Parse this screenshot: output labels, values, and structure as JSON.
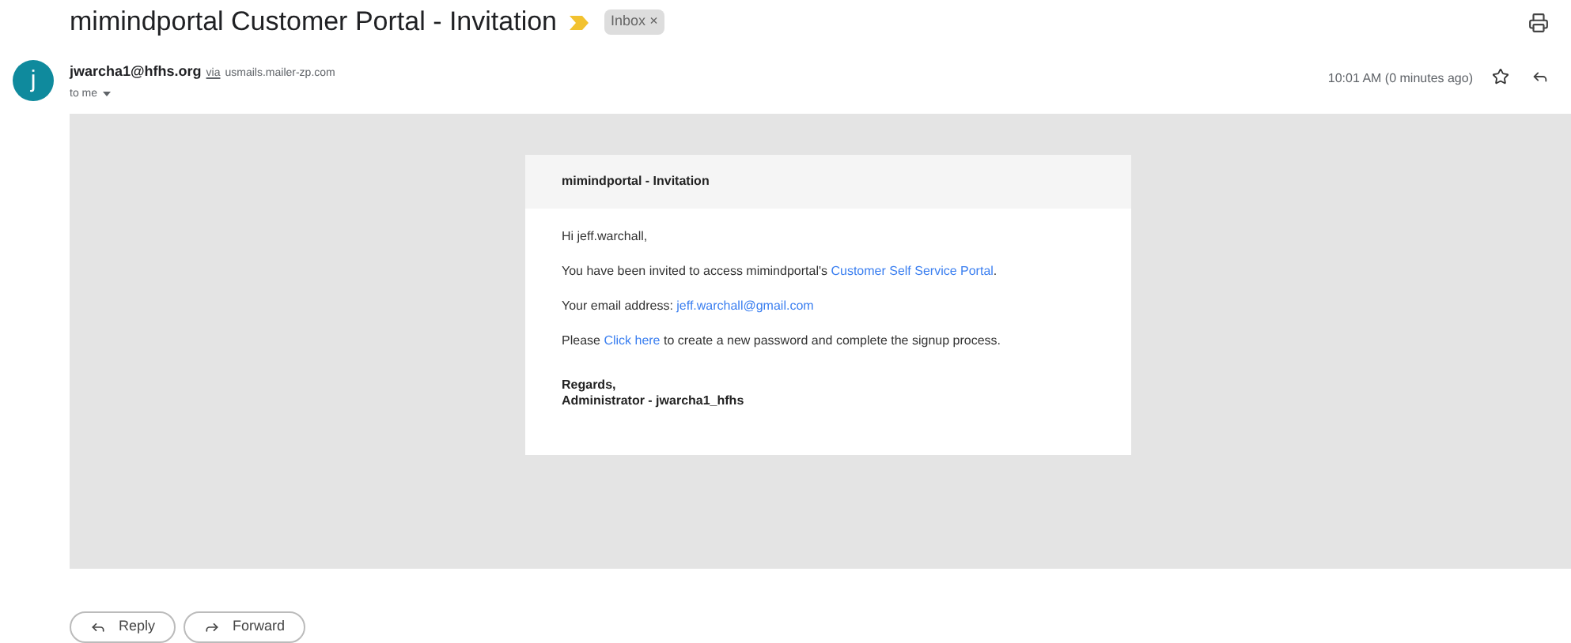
{
  "subject": "mimindportal Customer Portal - Invitation",
  "label": {
    "text": "Inbox",
    "remove": "×"
  },
  "sender": {
    "avatar": "j",
    "email": "jwarcha1@hfhs.org",
    "via": "via",
    "domain": "usmails.mailer-zp.com",
    "to": "to me"
  },
  "time": "10:01 AM (0 minutes ago)",
  "starred": false,
  "card": {
    "title": "mimindportal - Invitation",
    "paragraphs": [
      [
        {
          "kind": "text",
          "text": "Hi jeff.warchall,"
        }
      ],
      [
        {
          "kind": "text",
          "text": "You have been invited to access mimindportal's "
        },
        {
          "kind": "link",
          "text": "Customer Self Service Portal"
        },
        {
          "kind": "text",
          "text": "."
        }
      ],
      [
        {
          "kind": "text",
          "text": "Your email address: "
        },
        {
          "kind": "link",
          "text": "jeff.warchall@gmail.com"
        }
      ],
      [
        {
          "kind": "text",
          "text": "Please "
        },
        {
          "kind": "link",
          "text": "Click here"
        },
        {
          "kind": "text",
          "text": " to create a new password and complete the signup process."
        }
      ]
    ],
    "signature": [
      "Regards,",
      "Administrator - jwarcha1_hfhs"
    ]
  },
  "buttons": [
    {
      "kind": "reply",
      "label": "Reply"
    },
    {
      "kind": "forward",
      "label": "Forward"
    }
  ]
}
